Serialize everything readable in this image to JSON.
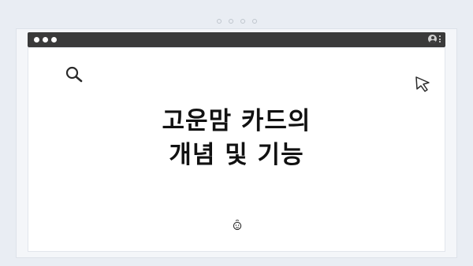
{
  "header": {
    "indicator_count": 4
  },
  "window": {
    "titlebar": {
      "controls": [
        "close",
        "minimize",
        "maximize"
      ],
      "icons": [
        "avatar-icon",
        "kebab-menu-icon"
      ]
    }
  },
  "slide": {
    "title_line1": "고운맘 카드의",
    "title_line2": "개념 및 기능",
    "icons": [
      "search-icon",
      "cursor-arrow-icon",
      "smile-icon"
    ]
  },
  "colors": {
    "background": "#e9edf3",
    "titlebar": "#3a3a3a",
    "content": "#ffffff",
    "text": "#111111"
  }
}
